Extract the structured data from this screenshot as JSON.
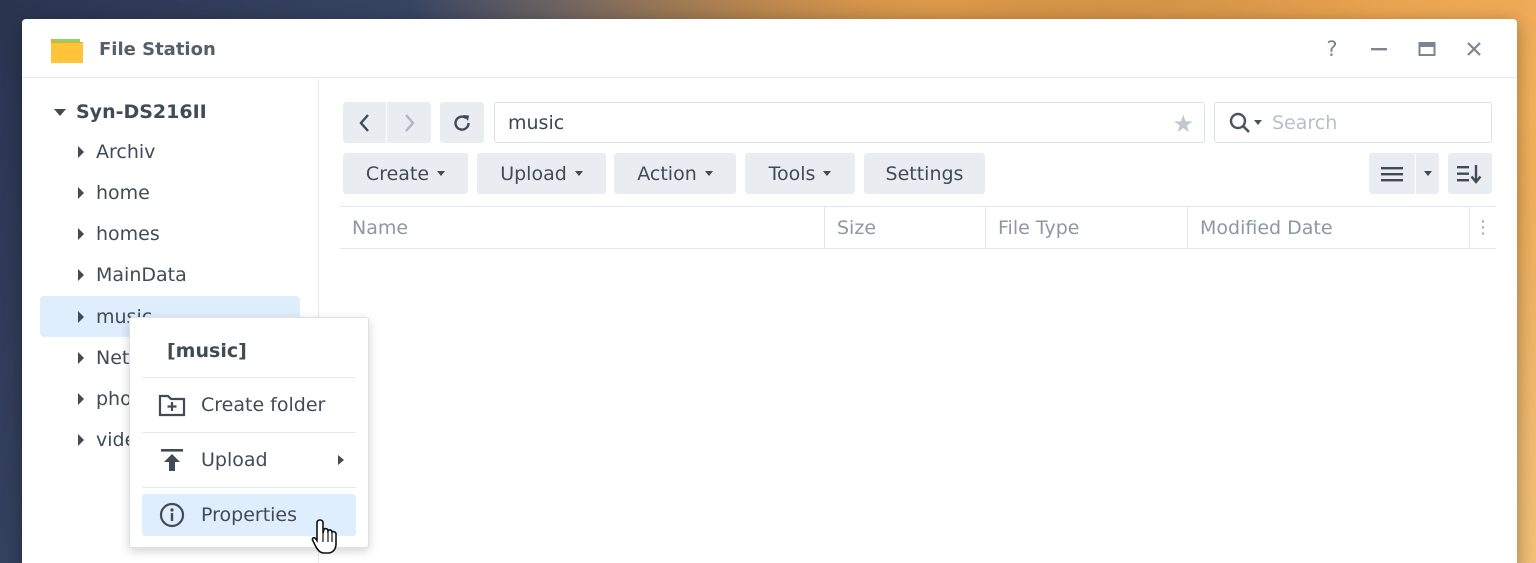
{
  "window": {
    "title": "File Station"
  },
  "title_controls": {
    "help": "?"
  },
  "sidebar": {
    "root": "Syn-DS216II",
    "items": [
      {
        "label": "Archiv"
      },
      {
        "label": "home"
      },
      {
        "label": "homes"
      },
      {
        "label": "MainData"
      },
      {
        "label": "music",
        "selected": true
      },
      {
        "label": "Net"
      },
      {
        "label": "pho"
      },
      {
        "label": "vide"
      }
    ]
  },
  "toolbar": {
    "path": "music",
    "search_placeholder": "Search",
    "create": "Create",
    "upload": "Upload",
    "action": "Action",
    "tools": "Tools",
    "settings": "Settings"
  },
  "grid": {
    "columns": [
      "Name",
      "Size",
      "File Type",
      "Modified Date"
    ]
  },
  "context_menu": {
    "title": "[music]",
    "items": [
      {
        "label": "Create folder",
        "icon": "create-folder-icon"
      },
      {
        "label": "Upload",
        "icon": "upload-icon"
      },
      {
        "label": "Properties",
        "icon": "info-icon",
        "highlighted": true
      }
    ]
  },
  "colors": {
    "accent_selected": "#dfeefc",
    "button_bg": "#e9edf2",
    "text": "#414b55"
  }
}
